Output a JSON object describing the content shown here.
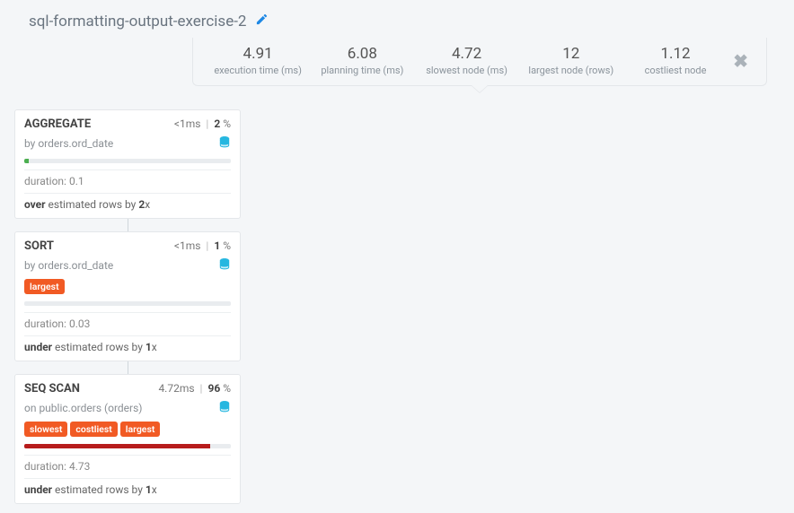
{
  "title": "sql-formatting-output-exercise-2",
  "stats": [
    {
      "value": "4.91",
      "label": "execution time (ms)"
    },
    {
      "value": "6.08",
      "label": "planning time (ms)"
    },
    {
      "value": "4.72",
      "label": "slowest node (ms)"
    },
    {
      "value": "12",
      "label": "largest node (rows)"
    },
    {
      "value": "1.12",
      "label": "costliest node"
    }
  ],
  "nodes": [
    {
      "title": "AGGREGATE",
      "time_text": "<1ms",
      "pct": "2",
      "sub_prefix": "by",
      "sub_target": "orders.ord_date",
      "badges": [],
      "bar_color": "green",
      "bar_pct": 2,
      "duration": "0.1",
      "est_dir": "over",
      "est_factor": "2"
    },
    {
      "title": "SORT",
      "time_text": "<1ms",
      "pct": "1",
      "sub_prefix": "by",
      "sub_target": "orders.ord_date",
      "badges": [
        "largest"
      ],
      "bar_color": "none",
      "bar_pct": 0,
      "duration": "0.03",
      "est_dir": "under",
      "est_factor": "1"
    },
    {
      "title": "SEQ SCAN",
      "time_text": "4.72ms",
      "pct": "96",
      "sub_prefix": "on",
      "sub_target": "public.orders (orders)",
      "badges": [
        "slowest",
        "costliest",
        "largest"
      ],
      "bar_color": "red",
      "bar_pct": 90,
      "duration": "4.73",
      "est_dir": "under",
      "est_factor": "1"
    }
  ],
  "labels": {
    "duration": "duration:",
    "est_mid": "estimated rows by",
    "est_suffix": "x"
  }
}
